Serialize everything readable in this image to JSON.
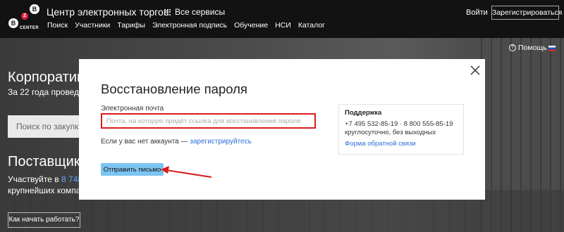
{
  "header": {
    "logo": {
      "left": "B",
      "badge": "2",
      "right": "B",
      "caption": "CENTER"
    },
    "title": "Центр электронных торгов",
    "services": "Все сервисы",
    "nav": [
      "Поиск",
      "Участники",
      "Тарифы",
      "Электронная подпись",
      "Обучение",
      "НСИ",
      "Каталог"
    ],
    "login": "Войти",
    "register": "Зарегистрироваться"
  },
  "background": {
    "help": "Помощь",
    "corp_title": "Корпоратив",
    "corp_sub": "За 22 года провед",
    "search_placeholder": "Поиск по закупк",
    "sup_title": "Поставщикам",
    "sup_sub_prefix": "Участвуйте в ",
    "sup_sub_number": "8 748",
    "sup_sub2": "крупнейших компан",
    "how_button": "Как начать работать?"
  },
  "modal": {
    "title": "Восстановление пароля",
    "email_label": "Электронная почта",
    "email_placeholder": "Почта, на которую придёт ссылка для восстановления пароля",
    "email_value": "",
    "no_account_text": "Если у вас нет аккаунта —",
    "register_link": "зарегистрируйтесь",
    "send_button": "Отправить письмо",
    "support": {
      "title": "Поддержка",
      "phones": "+7 495 532-85-19 · 8 800 555-85-19",
      "hours": "круглосуточно, без выходных",
      "feedback_link": "Форма обратной связи"
    }
  },
  "colors": {
    "header_bg": "#121212",
    "accent_button": "#7cc4f2",
    "highlight_red": "#d81c1c",
    "link_blue": "#2a6fd6",
    "logo_badge_red": "#e1203c"
  }
}
